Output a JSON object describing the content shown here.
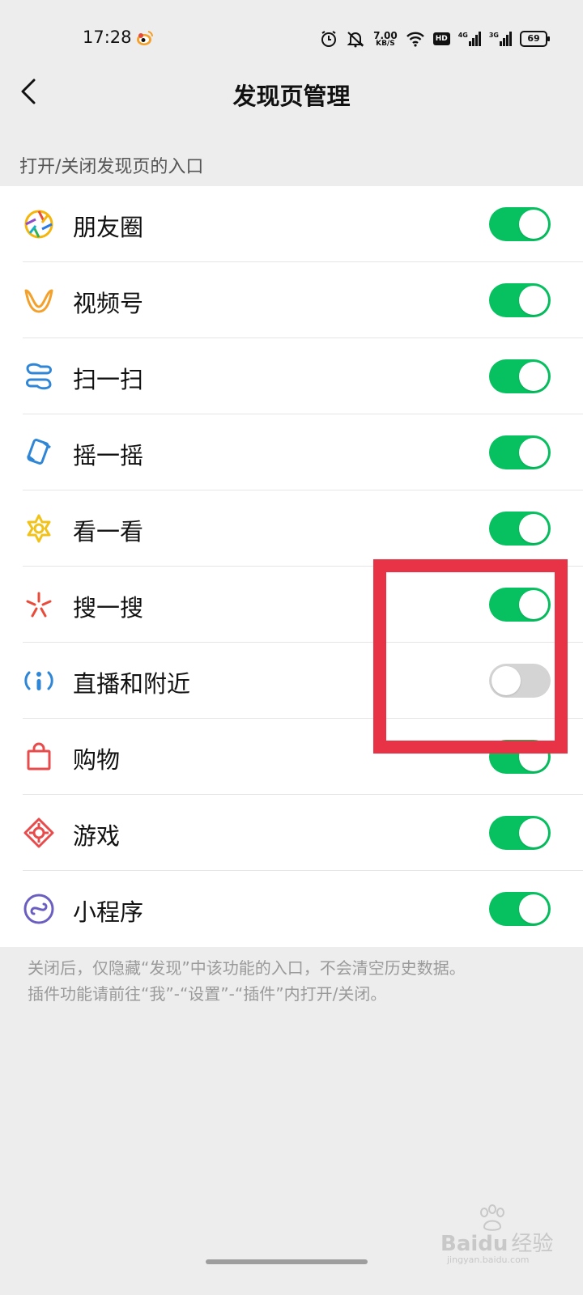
{
  "status_bar": {
    "time": "17:28",
    "net_speed_value": "7.00",
    "net_speed_unit": "KB/S",
    "hd_badge": "HD",
    "sig1_label": "4G",
    "sig2_label": "3G",
    "battery": "69"
  },
  "nav": {
    "title": "发现页管理"
  },
  "section_header": "打开/关闭发现页的入口",
  "items": [
    {
      "label": "朋友圈",
      "icon": "moments-icon",
      "enabled": true
    },
    {
      "label": "视频号",
      "icon": "channels-icon",
      "enabled": true
    },
    {
      "label": "扫一扫",
      "icon": "scan-icon",
      "enabled": true
    },
    {
      "label": "摇一摇",
      "icon": "shake-icon",
      "enabled": true
    },
    {
      "label": "看一看",
      "icon": "top-stories-icon",
      "enabled": true
    },
    {
      "label": "搜一搜",
      "icon": "search-icon",
      "enabled": true
    },
    {
      "label": "直播和附近",
      "icon": "live-nearby-icon",
      "enabled": false
    },
    {
      "label": "购物",
      "icon": "shopping-bag-icon",
      "enabled": true
    },
    {
      "label": "游戏",
      "icon": "games-icon",
      "enabled": true
    },
    {
      "label": "小程序",
      "icon": "mini-programs-icon",
      "enabled": true
    }
  ],
  "footer": {
    "line1": "关闭后，仅隐藏“发现”中该功能的入口，不会清空历史数据。",
    "line2": "插件功能请前往“我”-“设置”-“插件”内打开/关闭。"
  },
  "watermark": {
    "brand": "Baidu",
    "suffix": "经验",
    "url": "jingyan.baidu.com"
  },
  "colors": {
    "toggle_on": "#07c160",
    "toggle_off": "#d4d4d4",
    "highlight": "#e83346",
    "background": "#ededed"
  }
}
